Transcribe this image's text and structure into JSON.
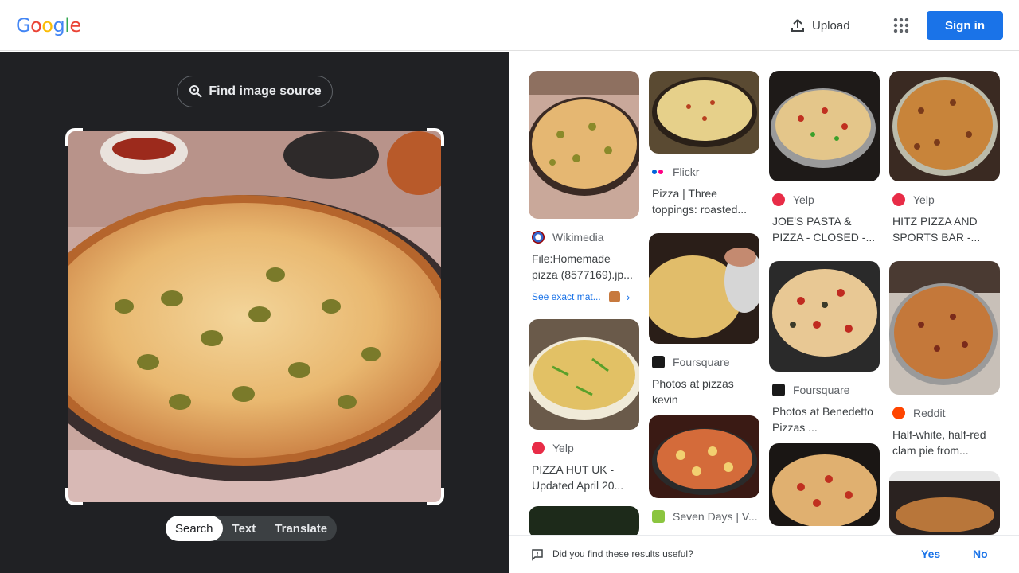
{
  "header": {
    "logo_letters": [
      {
        "ch": "G",
        "color": "#4285F4"
      },
      {
        "ch": "o",
        "color": "#EA4335"
      },
      {
        "ch": "o",
        "color": "#FBBC05"
      },
      {
        "ch": "g",
        "color": "#4285F4"
      },
      {
        "ch": "l",
        "color": "#34A853"
      },
      {
        "ch": "e",
        "color": "#EA4335"
      }
    ],
    "upload_label": "Upload",
    "apps_icon": "apps-grid-icon",
    "signin_label": "Sign in"
  },
  "lens": {
    "find_source_label": "Find image source",
    "modes": [
      {
        "label": "Search",
        "active": true
      },
      {
        "label": "Text",
        "active": false
      },
      {
        "label": "Translate",
        "active": false
      }
    ]
  },
  "results": [
    {
      "col": 0,
      "source": "Wikimedia",
      "title": "File:Homemade pizza (8577169).jp...",
      "exact_match": "See exact mat..."
    },
    {
      "col": 0,
      "source": "Yelp",
      "title": "PIZZA HUT UK - Updated April 20..."
    },
    {
      "col": 1,
      "source": "Flickr",
      "title": "Pizza | Three toppings: roasted..."
    },
    {
      "col": 1,
      "source": "Foursquare",
      "title": "Photos at pizzas kevin"
    },
    {
      "col": 1,
      "source": "Seven Days | V...",
      "title": ""
    },
    {
      "col": 2,
      "source": "Yelp",
      "title": "JOE'S PASTA & PIZZA - CLOSED -..."
    },
    {
      "col": 2,
      "source": "Foursquare",
      "title": "Photos at Benedetto Pizzas ..."
    },
    {
      "col": 3,
      "source": "Yelp",
      "title": "HITZ PIZZA AND SPORTS BAR -..."
    },
    {
      "col": 3,
      "source": "Reddit",
      "title": "Half-white, half-red clam pie from..."
    }
  ],
  "feedback": {
    "question": "Did you find these results useful?",
    "yes": "Yes",
    "no": "No"
  },
  "colors": {
    "accent": "#1a73e8",
    "dark_pane": "#202124"
  }
}
